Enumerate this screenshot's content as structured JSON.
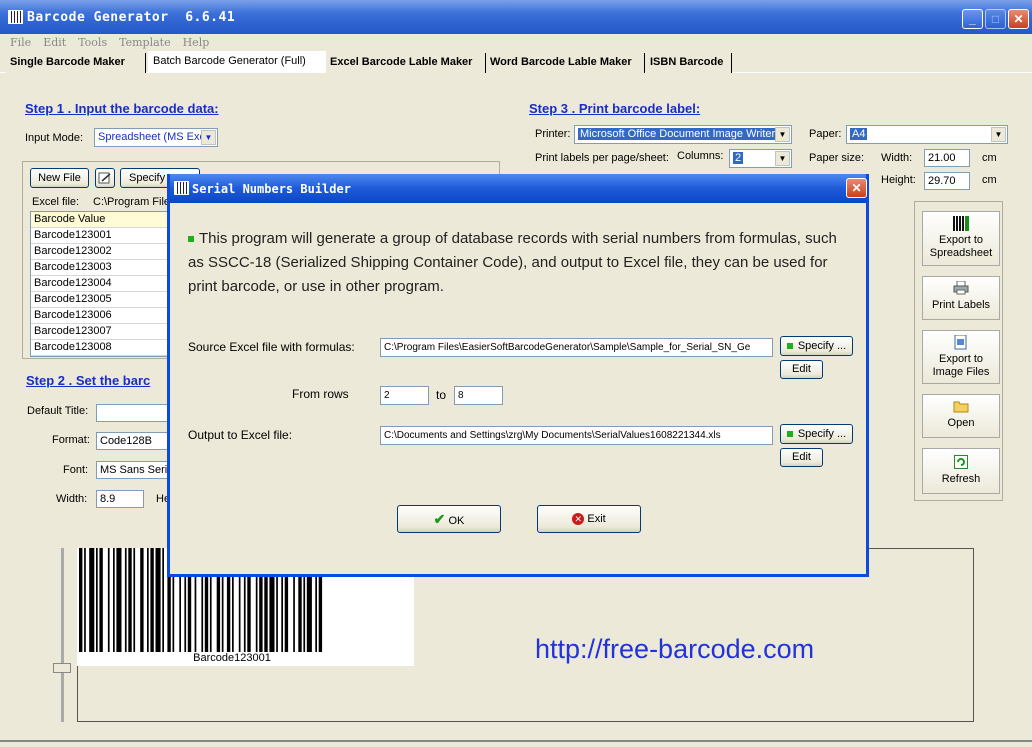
{
  "window": {
    "title": "Barcode Generator  6.6.41",
    "min": "_",
    "max": "□",
    "close": "✕"
  },
  "menu": [
    "File",
    "Edit",
    "Tools",
    "Template",
    "Help"
  ],
  "tabs": [
    "Single Barcode Maker",
    "Batch Barcode Generator (Full)",
    "Excel Barcode Lable Maker",
    "Word Barcode Lable Maker",
    "ISBN Barcode"
  ],
  "step1": {
    "heading": "Step 1 .  Input the barcode data:",
    "input_mode_label": "Input Mode:",
    "input_mode_value": "Spreadsheet (MS Exc",
    "new_file": "New File",
    "specify": "Specify",
    "excel_file_label": "Excel file:",
    "excel_file_value": "C:\\Program File",
    "rows": [
      "Barcode Value",
      "Barcode123001",
      "Barcode123002",
      "Barcode123003",
      "Barcode123004",
      "Barcode123005",
      "Barcode123006",
      "Barcode123007",
      "Barcode123008"
    ]
  },
  "step2": {
    "heading": "Step 2 . Set the barc",
    "default_title_label": "Default Title:",
    "format_label": "Format:",
    "format_value": "Code128B",
    "font_label": "Font:",
    "font_value": "MS Sans Serif",
    "width_label": "Width:",
    "width_value": "8.9",
    "height_label_partial": "He"
  },
  "step3": {
    "heading": "Step 3 . Print barcode label:",
    "printer_label": "Printer:",
    "printer_value": "Microsoft Office Document Image Writer",
    "paper_label": "Paper:",
    "paper_value": "A4",
    "per_page_label": "Print labels per page/sheet:",
    "columns_label": "Columns:",
    "columns_value": "2",
    "paper_size_label": "Paper size:",
    "width_label": "Width:",
    "width_value": "21.00",
    "height_label": "Height:",
    "height_value": "29.70",
    "unit": "cm"
  },
  "side_buttons": [
    {
      "label": "Export to Spreadsheet",
      "icon": "barcode-icon"
    },
    {
      "label": "Print Labels",
      "icon": "printer-icon"
    },
    {
      "label": "Export to Image Files",
      "icon": "image-icon"
    },
    {
      "label": "Open",
      "icon": "folder-icon"
    },
    {
      "label": "Refresh",
      "icon": "refresh-icon"
    }
  ],
  "preview": {
    "barcode_text": "Barcode123001",
    "url": "http://free-barcode.com"
  },
  "dialog": {
    "title": "Serial Numbers Builder",
    "description": "This program will generate a group of database records with serial numbers from formulas, such as SSCC-18 (Serialized Shipping Container Code), and output to Excel file, they can be used for print barcode, or use in other program.",
    "source_label": "Source Excel file with formulas:",
    "source_value": "C:\\Program Files\\EasierSoftBarcodeGenerator\\Sample\\Sample_for_Serial_SN_Ge",
    "specify": "Specify ...",
    "edit": "Edit",
    "from_rows_label": "From rows",
    "from_value": "2",
    "to_label": "to",
    "to_value": "8",
    "output_label": "Output to Excel file:",
    "output_value": "C:\\Documents and Settings\\zrg\\My Documents\\SerialValues1608221344.xls",
    "ok": "OK",
    "exit": "Exit"
  },
  "colors": {
    "heading": "#1a2dc8",
    "title_bar": "#2458c8",
    "url": "#2233dd"
  }
}
